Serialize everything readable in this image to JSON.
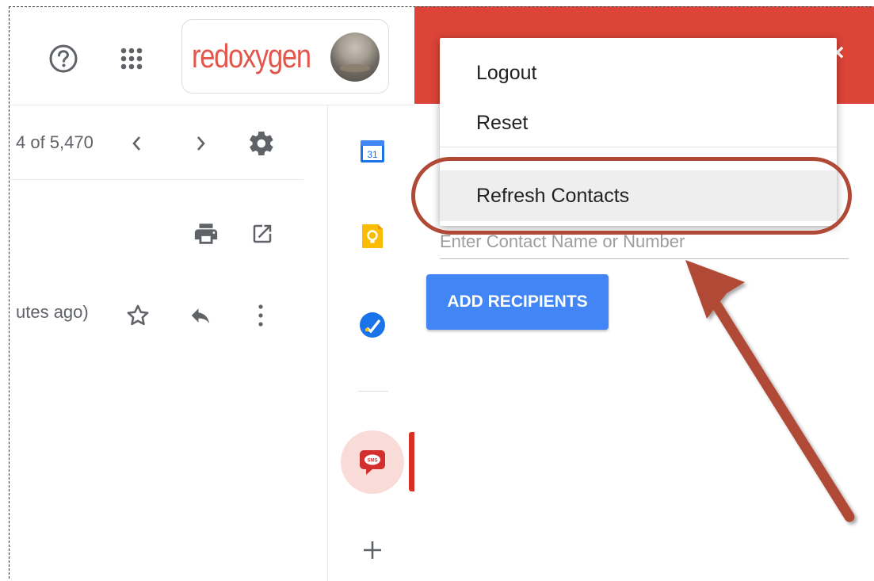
{
  "header": {
    "brand": {
      "logo_text": "redoxygen"
    }
  },
  "mail_toolbar": {
    "pagination_text": "4 of 5,470"
  },
  "message": {
    "time_text": "utes ago)"
  },
  "addon_panel": {
    "accent_color": "#db4437",
    "menu": {
      "items": [
        {
          "label": "Logout"
        },
        {
          "label": "Reset"
        },
        {
          "label": "Refresh Contacts"
        }
      ]
    },
    "contact_input": {
      "placeholder": "Enter Contact Name or Number"
    },
    "add_recipients_label": "ADD RECIPIENTS"
  },
  "side_panel": {
    "calendar_day": "31",
    "sms_badge_text": "SMS"
  },
  "colors": {
    "primary_button": "#4285f4",
    "annotation": "#b04a36"
  }
}
